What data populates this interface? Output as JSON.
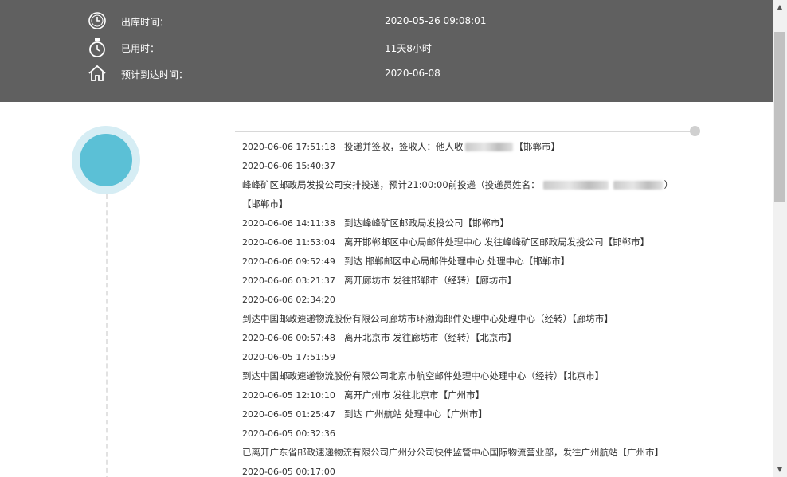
{
  "header": {
    "rows": [
      {
        "label": "出库时间：",
        "value": "2020-05-26 09:08:01",
        "icon": "clock-icon"
      },
      {
        "label": "已用时：",
        "value": "11天8小时",
        "icon": "stopwatch-icon"
      },
      {
        "label": "预计到达时间：",
        "value": "2020-06-08",
        "icon": "home-icon"
      }
    ]
  },
  "entries": [
    {
      "time": "2020-06-06 17:51:18",
      "text": "投递并签收，签收人：他人收",
      "suffix": "【邯郸市】"
    },
    {
      "time": "2020-06-06 15:40:37",
      "text": ""
    },
    {
      "time": "",
      "text": "峰峰矿区邮政局发投公司安排投递，预计21:00:00前投递（投递员姓名：",
      "suffix": "）"
    },
    {
      "time": "",
      "text": "【邯郸市】"
    },
    {
      "time": "2020-06-06 14:11:38",
      "text": "到达峰峰矿区邮政局发投公司【邯郸市】"
    },
    {
      "time": "2020-06-06 11:53:04",
      "text": "离开邯郸邮区中心局邮件处理中心 发往峰峰矿区邮政局发投公司【邯郸市】"
    },
    {
      "time": "2020-06-06 09:52:49",
      "text": "到达 邯郸邮区中心局邮件处理中心 处理中心【邯郸市】"
    },
    {
      "time": "2020-06-06 03:21:37",
      "text": "离开廊坊市 发往邯郸市（经转）【廊坊市】"
    },
    {
      "time": "2020-06-06 02:34:20",
      "text": ""
    },
    {
      "time": "",
      "text": "到达中国邮政速递物流股份有限公司廊坊市环渤海邮件处理中心处理中心（经转）【廊坊市】"
    },
    {
      "time": "2020-06-06 00:57:48",
      "text": "离开北京市 发往廊坊市（经转）【北京市】"
    },
    {
      "time": "2020-06-05 17:51:59",
      "text": ""
    },
    {
      "time": "",
      "text": "到达中国邮政速递物流股份有限公司北京市航空邮件处理中心处理中心（经转）【北京市】"
    },
    {
      "time": "2020-06-05 12:10:10",
      "text": "离开广州市 发往北京市【广州市】"
    },
    {
      "time": "2020-06-05 01:25:47",
      "text": "到达 广州航站 处理中心【广州市】"
    },
    {
      "time": "2020-06-05 00:32:36",
      "text": ""
    },
    {
      "time": "",
      "text": "已离开广东省邮政速递物流有限公司广州分公司快件监管中心国际物流营业部，发往广州航站【广州市】"
    },
    {
      "time": "2020-06-05 00:17:00",
      "text": ""
    }
  ],
  "colors": {
    "header_bg": "#606060",
    "accent": "#5bc0d6",
    "ring": "#d6edf4"
  }
}
